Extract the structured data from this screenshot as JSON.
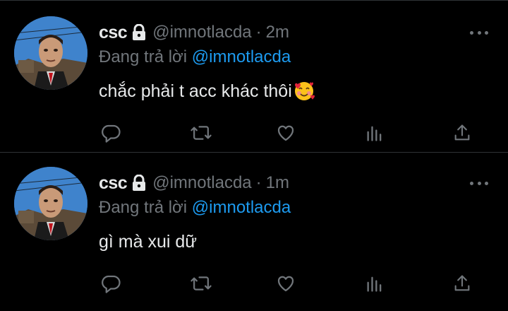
{
  "colors": {
    "background": "#000000",
    "text": "#e7e9ea",
    "muted": "#71767b",
    "accent": "#1d9bf0",
    "divider": "#2f3336"
  },
  "tweets": [
    {
      "name": "csc",
      "handle": "@imnotlacda",
      "separator": "·",
      "time": "2m",
      "reply_prefix": "Đang trả lời ",
      "reply_to": "@imnotlacda",
      "text": "chắc phải t acc khác thôi",
      "emoji": "smiling-face-with-hearts-icon",
      "icons": [
        "lock-icon",
        "more-icon",
        "reply-icon",
        "retweet-icon",
        "like-icon",
        "views-icon",
        "share-icon"
      ]
    },
    {
      "name": "csc",
      "handle": "@imnotlacda",
      "separator": "·",
      "time": "1m",
      "reply_prefix": "Đang trả lời ",
      "reply_to": "@imnotlacda",
      "text": "gì mà xui dữ",
      "icons": [
        "lock-icon",
        "more-icon",
        "reply-icon",
        "retweet-icon",
        "like-icon",
        "views-icon",
        "share-icon"
      ]
    }
  ]
}
